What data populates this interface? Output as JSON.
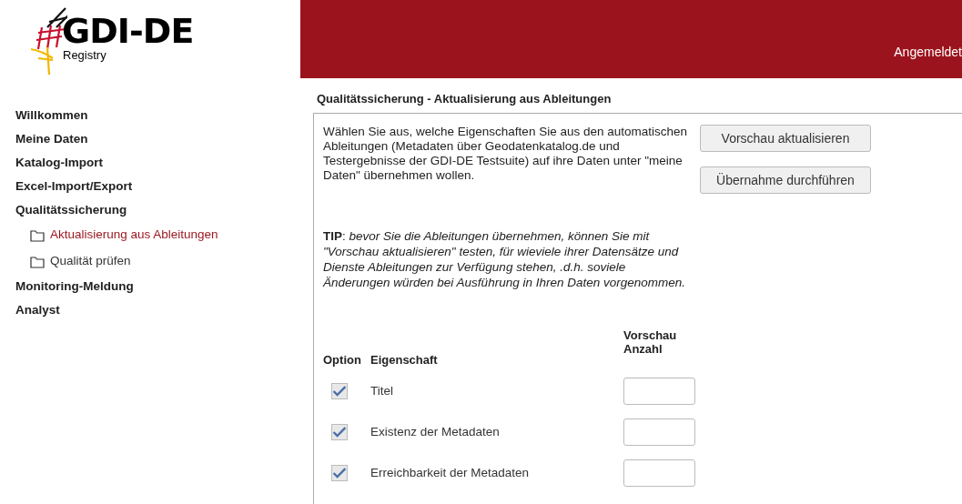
{
  "logo": {
    "title": "GDI-DE",
    "subtitle": "Registry"
  },
  "header": {
    "user_label": "Angemeldet"
  },
  "nav": [
    {
      "label": "Willkommen",
      "selected": false
    },
    {
      "label": "Meine Daten",
      "selected": false
    },
    {
      "label": "Katalog-Import",
      "selected": false
    },
    {
      "label": "Excel-Import/Export",
      "selected": false
    },
    {
      "label": "Qualitätssicherung",
      "selected": false,
      "children": [
        {
          "label": "Aktualisierung aus Ableitungen",
          "selected": true
        },
        {
          "label": "Qualität prüfen",
          "selected": false
        }
      ]
    },
    {
      "label": "Monitoring-Meldung",
      "selected": false
    },
    {
      "label": "Analyst",
      "selected": false
    }
  ],
  "page_title": "Qualitätssicherung - Aktualisierung aus Ableitungen",
  "intro": "Wählen Sie aus, welche Eigenschaften Sie aus den automatischen Ableitungen (Metadaten über Geodatenkatalog.de und Testergebnisse der GDI-DE Testsuite) auf ihre Daten unter \"meine Daten\" übernehmen wollen.",
  "buttons": [
    "Vorschau aktualisieren",
    "Übernahme durchführen"
  ],
  "tip": "**TIP**: *bevor Sie die Ableitungen übernehmen, können Sie mit \"Vorschau aktualisieren\" testen, für wieviele ihrer Datensätze und Dienste Ableitungen zur Verfügung stehen, .d.h. soviele Änderungen würden bei Ausführung in Ihren Daten vorgenommen.*",
  "table": {
    "columns": [
      "Option",
      "Eigenschaft",
      "Vorschau Anzahl"
    ],
    "rows": [
      {
        "checked": true,
        "property": "Titel"
      },
      {
        "checked": true,
        "property": "Existenz der Metadaten"
      },
      {
        "checked": true,
        "property": "Erreichbarkeit der Metadaten"
      }
    ]
  }
}
